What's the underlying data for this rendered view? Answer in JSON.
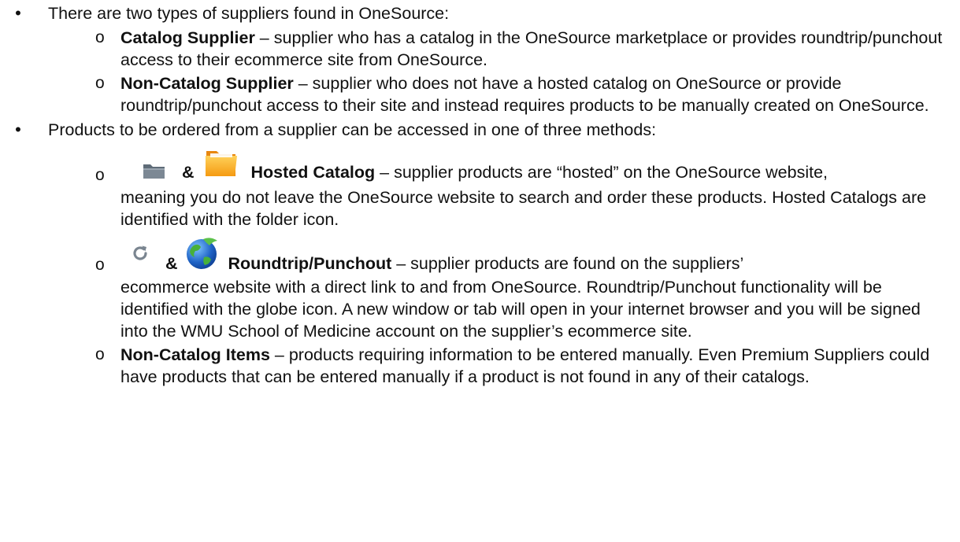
{
  "items": [
    {
      "text": "There are two types of suppliers found in OneSource:",
      "sub": [
        {
          "bold": "Catalog Supplier",
          "rest": " – supplier who has a catalog in the OneSource marketplace or provides roundtrip/punchout access to their ecommerce site from OneSource."
        },
        {
          "bold": "Non-Catalog Supplier",
          "rest": " – supplier who does not have a hosted catalog on OneSource or provide roundtrip/punchout access to their site and instead requires products to be manually created on OneSource."
        }
      ]
    },
    {
      "text": "Products to be ordered from a supplier can be accessed in one of three methods:",
      "sub": [
        {
          "amp": "&",
          "bold": "Hosted Catalog",
          "rest_first": " – supplier products are “hosted” on the OneSource website,",
          "rest": "meaning you do not leave the OneSource website to search and order these products. Hosted Catalogs are identified with the folder icon."
        },
        {
          "amp": "&",
          "bold": "Roundtrip/Punchout",
          "rest_first": " – supplier products are found on the suppliers’",
          "rest": "ecommerce website with a direct link to and from OneSource.  Roundtrip/Punchout functionality will be identified with the globe icon. A new window or tab will open in your internet browser and you will be signed into the WMU School of Medicine account on the supplier’s ecommerce site."
        },
        {
          "bold": "Non-Catalog Items",
          "rest": " – products requiring information to be entered manually.  Even Premium Suppliers could have products that can be entered manually if a product is not found in any of their catalogs."
        }
      ]
    }
  ],
  "bullets": {
    "level1": "•",
    "level2": "o"
  },
  "icons": {
    "folder_gray": "folder-gray-icon",
    "folder_orange": "folder-orange-icon",
    "refresh": "refresh-icon",
    "globe": "globe-icon"
  },
  "colors": {
    "text": "#111111",
    "folder_gray": "#6d7a86",
    "folder_orange": "#f7a21b",
    "globe_blue": "#1f63c6",
    "globe_green": "#47b03a"
  }
}
